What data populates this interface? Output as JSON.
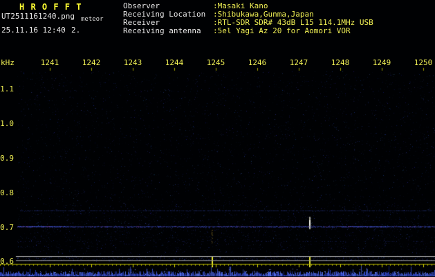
{
  "header": {
    "app_title": "H R O F F T",
    "filename": "UT2511161240.png",
    "band_label": "meteor",
    "datetime": "25.11.16 12:40",
    "count": "2.",
    "info": [
      {
        "label": "Observer",
        "value": ":Masaki Kano"
      },
      {
        "label": "Receiving Location",
        "value": ":Shibukawa,Gunma,Japan"
      },
      {
        "label": "Receiver",
        "value": ":RTL-SDR SDR# 43dB L15 114.1MHz USB"
      },
      {
        "label": "Receiving antenna",
        "value": ":5el Yagi Az 20 for Aomori VOR"
      }
    ]
  },
  "axes": {
    "y_unit": "kHz",
    "x_ticks": [
      "1241",
      "1242",
      "1243",
      "1244",
      "1245",
      "1246",
      "1247",
      "1248",
      "1249",
      "1250"
    ],
    "y_ticks": [
      "1.1",
      "1.0",
      "0.9",
      "0.8",
      "0.7",
      "0.6"
    ]
  },
  "chart_data": {
    "type": "heatmap",
    "subtype": "radio-meteor-spectrogram",
    "title": "HROFFT 10-minute meteor echo spectrogram",
    "x_range_minutes": [
      1240,
      1250
    ],
    "x_tick_labels": [
      "1241",
      "1242",
      "1243",
      "1244",
      "1245",
      "1246",
      "1247",
      "1248",
      "1249",
      "1250"
    ],
    "y_range_khz": [
      0.6,
      1.15
    ],
    "y_tick_khz": [
      1.1,
      1.0,
      0.9,
      0.8,
      0.7,
      0.6
    ],
    "noise_floor": "faint blue speckle over near-black background",
    "carriers": [
      {
        "khz": 0.748,
        "strength": "faint",
        "appearance": "thin intermittent blue line"
      },
      {
        "khz": 0.702,
        "strength": "strong",
        "appearance": "continuous blue/purple carrier line"
      },
      {
        "khz": 0.66,
        "strength": "trace",
        "appearance": "sparse blue dashes"
      }
    ],
    "events": [
      {
        "time_min": 1244.9,
        "khz": 0.674,
        "height_khz": 0.044,
        "intensity": "dim",
        "appearance": "faint yellow-orange meteor echo streak with bottom-axis tick"
      },
      {
        "time_min": 1247.25,
        "khz": 0.712,
        "height_khz": 0.036,
        "intensity": "bright",
        "appearance": "bright white meteor echo with bottom-axis tick"
      }
    ],
    "reference_lines": {
      "white_pair_y_khz": [
        0.616,
        0.604
      ],
      "color": "#b8b8b8"
    },
    "level_trace": {
      "position": "bottom strip",
      "color": "#2a3cd0",
      "description": "jagged blue signal-level trace along full width"
    }
  },
  "colors": {
    "background": "#000000",
    "accent_yellow": "#f0f055",
    "text_white": "#e8e8e8",
    "title_yellow": "#ffff33",
    "noise_blue": "#2030c0",
    "carrier_blue": "#4b5feb",
    "carrier_purple": "#9b5fe1",
    "event_bright": "#eeeeda",
    "event_dim": "#b99630",
    "white_line": "#b8b8b8",
    "axis_yellow": "#b8b800"
  }
}
